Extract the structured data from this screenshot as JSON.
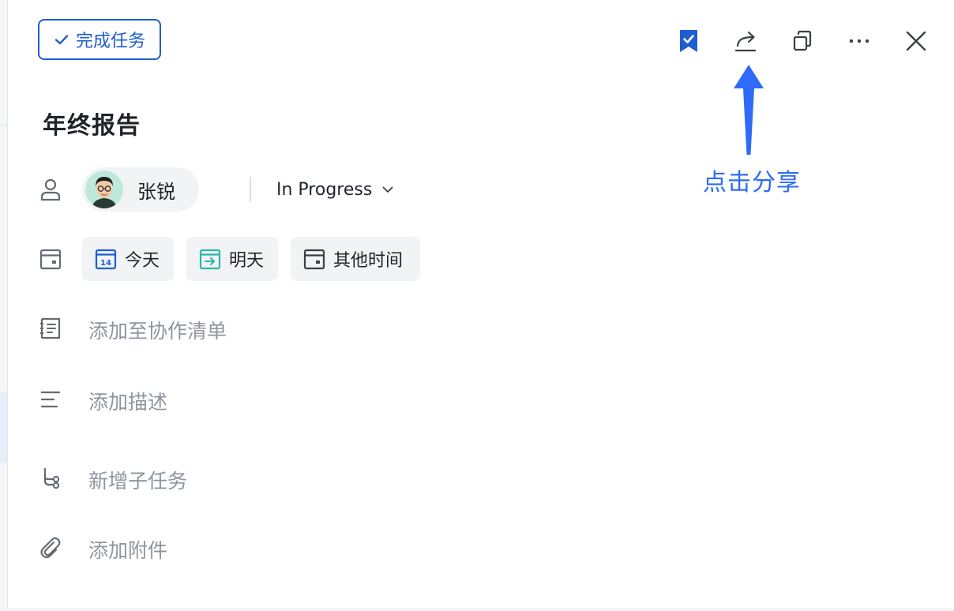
{
  "header": {
    "complete_label": "完成任务",
    "toolbar_icons": [
      "bookmark-check-icon",
      "share-icon",
      "copy-icon",
      "more-icon",
      "close-icon"
    ]
  },
  "task": {
    "title": "年终报告",
    "assignee": {
      "name": "张锐",
      "avatar_icon": "user-avatar"
    },
    "status": "In Progress"
  },
  "dates": {
    "today": {
      "label": "今天",
      "badge": "14"
    },
    "tomorrow": {
      "label": "明天"
    },
    "other": {
      "label": "其他时间"
    }
  },
  "rows": {
    "add_to_list": "添加至协作清单",
    "add_description": "添加描述",
    "add_subtask": "新增子任务",
    "add_attachment": "添加附件"
  },
  "annotation": {
    "text": "点击分享"
  },
  "colors": {
    "accent": "#1f5ecf",
    "annotation": "#2f6bf6",
    "tomorrow": "#2bb5a8",
    "placeholder": "#8f959e"
  }
}
